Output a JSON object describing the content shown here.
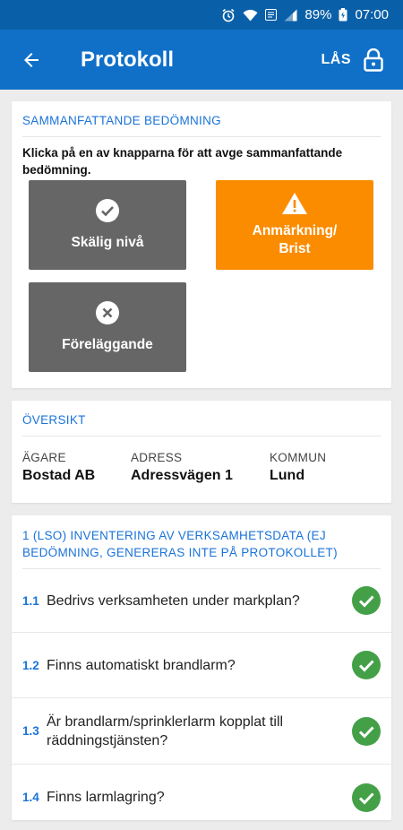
{
  "status_bar": {
    "battery_percent": "89%",
    "time": "07:00"
  },
  "app_bar": {
    "title": "Protokoll",
    "lock_label": "LÅS"
  },
  "summary": {
    "heading": "SAMMANFATTANDE BEDÖMNING",
    "instruction": "Klicka på en av knapparna för att avge sammanfattande bedömning.",
    "buttons": {
      "reasonable_label": "Skälig nivå",
      "remark_label": "Anmärkning/ Brist",
      "injunction_label": "Föreläggande"
    },
    "colors": {
      "neutral": "#666666",
      "selected": "#fb8c00"
    }
  },
  "overview": {
    "heading": "ÖVERSIKT",
    "fields": [
      {
        "label": "ÄGARE",
        "value": "Bostad AB"
      },
      {
        "label": "ADRESS",
        "value": "Adressvägen 1"
      },
      {
        "label": "KOMMUN",
        "value": "Lund"
      }
    ]
  },
  "section1": {
    "heading": "1 (LSO) INVENTERING AV VERKSAMHETSDATA (EJ BEDÖMNING, GENERERAS INTE PÅ PROTOKOLLET)",
    "questions": [
      {
        "number": "1.1",
        "text": "Bedrivs verksamheten under markplan?"
      },
      {
        "number": "1.2",
        "text": "Finns automatiskt brandlarm?"
      },
      {
        "number": "1.3",
        "text": "Är brandlarm/sprinklerlarm kopplat till räddningstjänsten?"
      },
      {
        "number": "1.4",
        "text": "Finns larmlagring?"
      }
    ]
  },
  "colors": {
    "primary": "#1070c8",
    "accent_text": "#1a73d9",
    "check_green": "#43a047"
  }
}
